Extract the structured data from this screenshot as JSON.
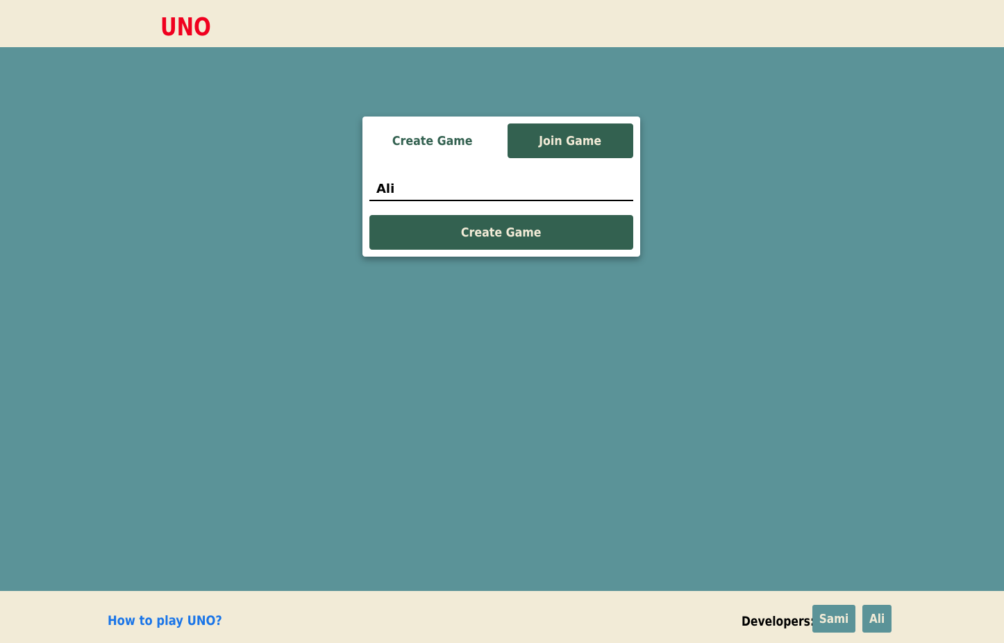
{
  "header": {
    "logo": "UNO"
  },
  "game_form": {
    "tabs": [
      {
        "label": "Create Game",
        "active": true
      },
      {
        "label": "Join Game",
        "active": false
      }
    ],
    "name_input": {
      "value": "Ali",
      "placeholder": ""
    },
    "submit_label": "Create Game"
  },
  "footer": {
    "howto_link": "How to play UNO?",
    "developers_label": "Developers:",
    "developers": [
      "Sami",
      "Ali"
    ]
  },
  "colors": {
    "brand_red": "#f0001f",
    "background_teal": "#5b9398",
    "dark_green": "#336150",
    "cream": "#f2ebd7",
    "link_blue": "#1a75e8"
  }
}
